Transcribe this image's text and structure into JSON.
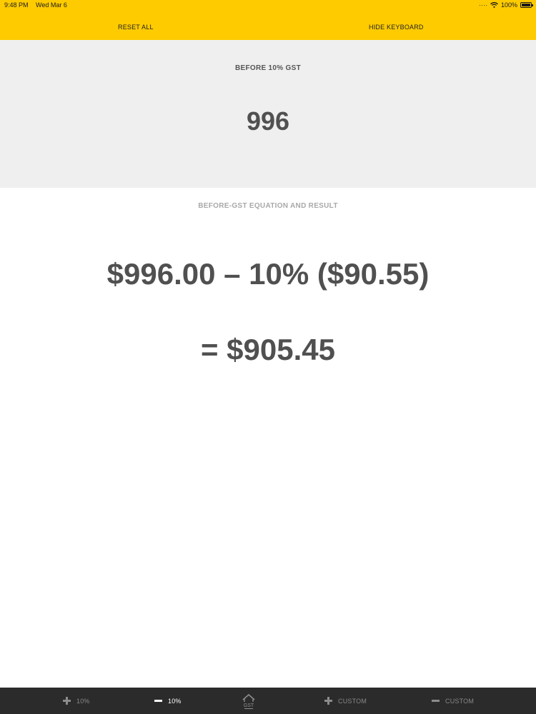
{
  "status_bar": {
    "time": "9:48 PM",
    "date": "Wed Mar 6",
    "signal": "····",
    "battery_pct": "100%"
  },
  "toolbar": {
    "reset_label": "RESET ALL",
    "hide_keyboard_label": "HIDE KEYBOARD"
  },
  "input": {
    "label": "BEFORE 10% GST",
    "value": "996"
  },
  "result": {
    "label": "BEFORE-GST EQUATION AND RESULT",
    "equation": "$996.00 – 10% ($90.55)",
    "value": "= $905.45"
  },
  "tabs": [
    {
      "label": "10%",
      "icon": "plus-icon"
    },
    {
      "label": "10%",
      "icon": "minus-icon",
      "active": true
    },
    {
      "label": "GST",
      "icon": "house-icon"
    },
    {
      "label": "CUSTOM",
      "icon": "plus-icon"
    },
    {
      "label": "CUSTOM",
      "icon": "minus-icon"
    }
  ],
  "colors": {
    "accent_yellow": "#fecb00",
    "panel_grey": "#efefef",
    "text_dark": "#505050",
    "text_light": "#a8a8a8",
    "tab_bar_bg": "#2b2b2b"
  }
}
